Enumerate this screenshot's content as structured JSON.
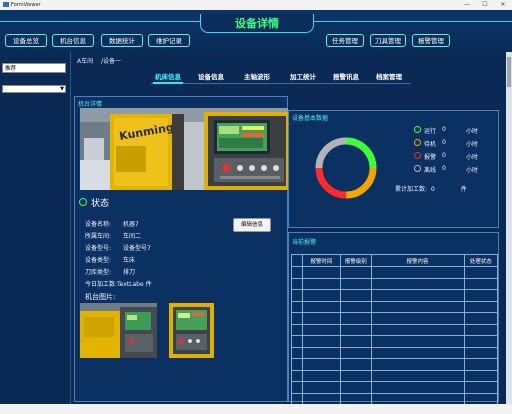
{
  "window": {
    "title": "FormViewer",
    "minimize": "—",
    "maximize": "☐",
    "close": "✕"
  },
  "header": {
    "title": "设备详情"
  },
  "nav_left": [
    "设备总览",
    "机台信息",
    "数据统计",
    "维护记录"
  ],
  "nav_right": [
    "任务管理",
    "刀具管理",
    "报警管理"
  ],
  "sidebar": {
    "search_value": "推荐",
    "select_value": ""
  },
  "breadcrumb": {
    "workshop": "A车间",
    "device": "/设备一"
  },
  "tabs": [
    "机床信息",
    "设备信息",
    "主轴波形",
    "加工统计",
    "报警讯息",
    "档案管理"
  ],
  "device_panel": {
    "title": "机台详情",
    "status_label": "状态",
    "fields": [
      {
        "label": "设备名称:",
        "value": "机器7"
      },
      {
        "label": "所属车间:",
        "value": "车间二"
      },
      {
        "label": "设备型号:",
        "value": "设备型号7"
      },
      {
        "label": "设备类型:",
        "value": "车床"
      },
      {
        "label": "刀库类型:",
        "value": "排刀"
      }
    ],
    "today_label": "今日加工数:",
    "today_value": "TextLabe 件",
    "edit_button": "编辑信息",
    "photos_label": "机台图片:",
    "brand_text": "Kunming"
  },
  "basic_panel": {
    "title": "设备基本数据",
    "legend": [
      {
        "name": "运行",
        "value": "0",
        "unit": "小时",
        "color": "#3fff3a"
      },
      {
        "name": "待机",
        "value": "0",
        "unit": "小时",
        "color": "#f4a300"
      },
      {
        "name": "报警",
        "value": "0",
        "unit": "小时",
        "color": "#ff2a2a"
      },
      {
        "name": "离线",
        "value": "0",
        "unit": "小时",
        "color": "#b4b4b4"
      }
    ],
    "total_label": "累计加工数:",
    "total_value": "0",
    "total_unit": "件"
  },
  "alarm_panel": {
    "title": "当前报警",
    "columns": [
      "报警时间",
      "报警级别",
      "报警内容",
      "处理状态"
    ]
  },
  "colors": {
    "accent": "#3ff5ff",
    "title": "#35ff7a",
    "background": "#0a2a55"
  }
}
